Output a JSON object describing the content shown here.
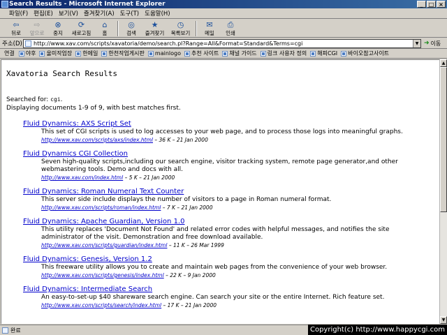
{
  "window": {
    "title": "Search Results - Microsoft Internet Explorer",
    "buttons": [
      "_",
      "□",
      "×"
    ]
  },
  "menu": [
    "파일(F)",
    "편집(E)",
    "보기(V)",
    "즐겨찾기(A)",
    "도구(T)",
    "도움말(H)"
  ],
  "toolbar": [
    {
      "label": "뒤로",
      "icon": "back-arrow-icon",
      "glyph": "⇦",
      "enabled": true
    },
    {
      "label": "앞으로",
      "icon": "forward-arrow-icon",
      "glyph": "⇨",
      "enabled": false
    },
    {
      "label": "중지",
      "icon": "stop-icon",
      "glyph": "⊗",
      "enabled": true
    },
    {
      "label": "새로고침",
      "icon": "refresh-icon",
      "glyph": "⟳",
      "enabled": true
    },
    {
      "label": "홈",
      "icon": "home-icon",
      "glyph": "⌂",
      "enabled": true
    },
    {
      "label": "검색",
      "icon": "search-icon",
      "glyph": "◎",
      "enabled": true
    },
    {
      "label": "즐겨찾기",
      "icon": "favorites-icon",
      "glyph": "★",
      "enabled": true
    },
    {
      "label": "목록보기",
      "icon": "history-icon",
      "glyph": "◷",
      "enabled": true
    },
    {
      "label": "메일",
      "icon": "mail-icon",
      "glyph": "✉",
      "enabled": true
    },
    {
      "label": "인쇄",
      "icon": "print-icon",
      "glyph": "⎙",
      "enabled": true
    }
  ],
  "address": {
    "label": "주소(D)",
    "url": "http://www.xav.com/scripts/xavatoria/demo/search.pl?Range=All&Format=Standard&Terms=cgi",
    "go_label": "이동"
  },
  "links": {
    "label": "연결",
    "items": [
      "야후",
      "울미작업장",
      "한메일",
      "한천작업게시판",
      "mainlogo",
      "추천 사이트",
      "채널 가이드",
      "링크 사용자 정의",
      "해피CGI",
      "바이오참고사이트"
    ]
  },
  "page": {
    "heading": "Xavatoria Search Results",
    "searched_for_label": "Searched for:",
    "searched_term": "cgi",
    "searched_suffix": ".",
    "displaying": "Displaying documents 1-9 of 9, with best matches first."
  },
  "results": [
    {
      "title": "Fluid Dynamics: AXS Script Set",
      "desc": "This set of CGI scripts is used to log accesses to your web page, and to process those logs into meaningful graphs.",
      "url": "http://www.xav.com/scripts/axs/index.html",
      "meta": " – 36 K – 21 Jan 2000"
    },
    {
      "title": "Fluid Dynamics CGI Collection",
      "desc": "Seven high-quality scripts,including our search engine, visitor tracking system, remote page generator,and other webmastering tools. Demo and docs with all.",
      "url": "http://www.xav.com/index.html",
      "meta": " – 5 K – 21 Jan 2000"
    },
    {
      "title": "Fluid Dynamics: Roman Numeral Text Counter",
      "desc": "This server side include displays the number of visitors to a page in Roman numeral format.",
      "url": "http://www.xav.com/scripts/roman/index.html",
      "meta": " – 7 K – 21 Jan 2000"
    },
    {
      "title": "Fluid Dynamics: Apache Guardian, Version 1.0",
      "desc": "This utility replaces 'Document Not Found' and related error codes with helpful messages, and notifies the site administrator of the visit. Demonstration and free download available.",
      "url": "http://www.xav.com/scripts/guardian/index.html",
      "meta": " – 11 K – 26 Mar 1999"
    },
    {
      "title": "Fluid Dynamics: Genesis, Version 1.2",
      "desc": "This freeware utility allows you to create and maintain web pages from the convenience of your web browser.",
      "url": "http://www.xav.com/scripts/genesis/index.html",
      "meta": " – 22 K – 9 Jan 2000"
    },
    {
      "title": "Fluid Dynamics: Intermediate Search",
      "desc": "An easy-to-set-up $40 shareware search engine. Can search your site or the entire Internet. Rich feature set.",
      "url": "http://www.xav.com/scripts/search/index.html",
      "meta": " – 17 K – 21 Jan 2000"
    }
  ],
  "status": {
    "text": "완료",
    "copyright": "Copyright(c) http://www.happycgi.com"
  }
}
